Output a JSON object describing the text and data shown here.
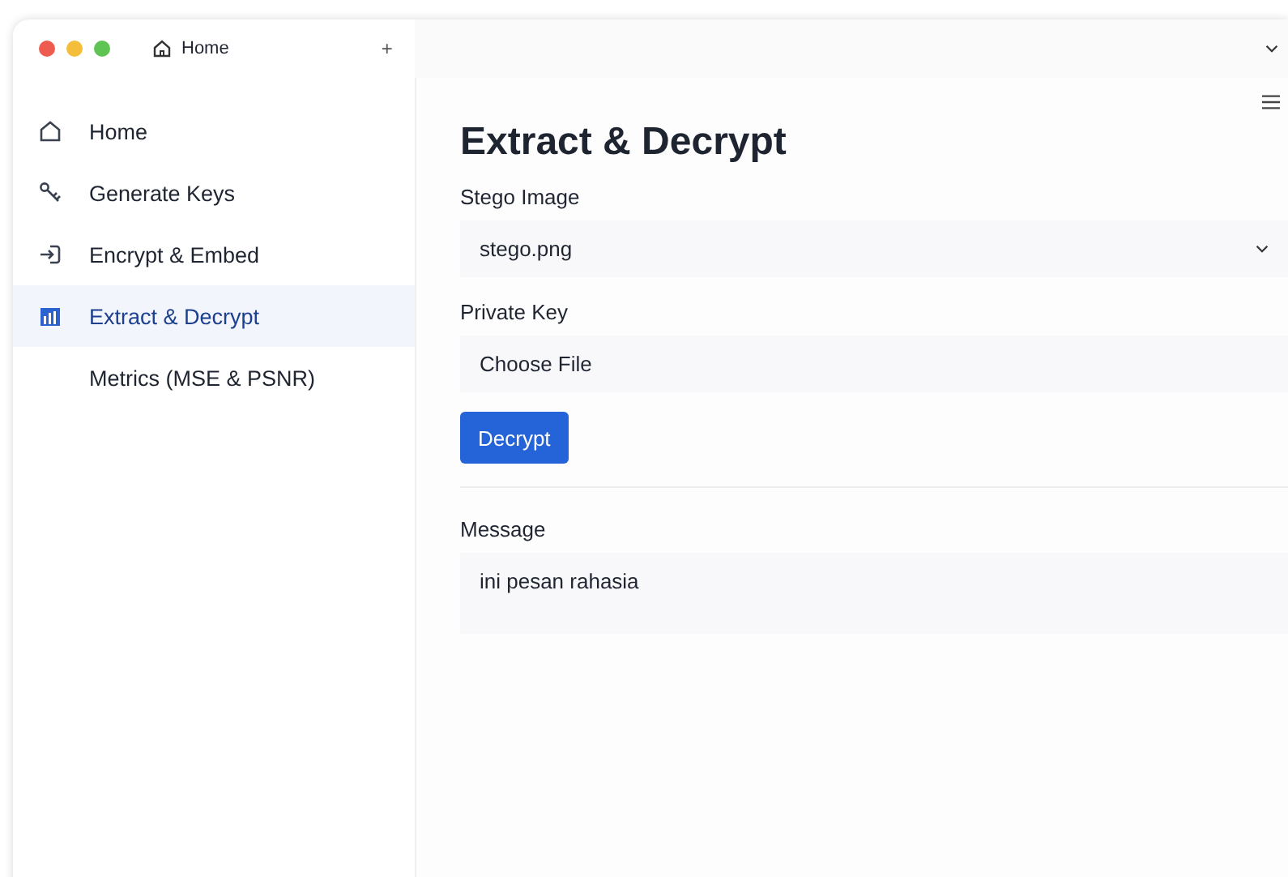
{
  "window": {
    "tab": {
      "label": "Home"
    },
    "new_tab": "+"
  },
  "sidebar": {
    "items": [
      {
        "label": "Home",
        "kind": "home",
        "selected": false
      },
      {
        "label": "Generate Keys",
        "kind": "keys",
        "selected": false
      },
      {
        "label": "Encrypt & Embed",
        "kind": "enter",
        "selected": false
      },
      {
        "label": "Extract & Decrypt",
        "kind": "chart",
        "selected": true
      },
      {
        "label": "Metrics (MSE & PSNR)",
        "kind": "none",
        "selected": false
      }
    ]
  },
  "main": {
    "title": "Extract & Decrypt",
    "stego_image": {
      "label": "Stego Image",
      "value": "stego.png"
    },
    "private_key": {
      "label": "Private Key",
      "button": "Choose File"
    },
    "decrypt_button": "Decrypt",
    "message": {
      "label": "Message",
      "value": "ini pesan rahasia"
    }
  }
}
